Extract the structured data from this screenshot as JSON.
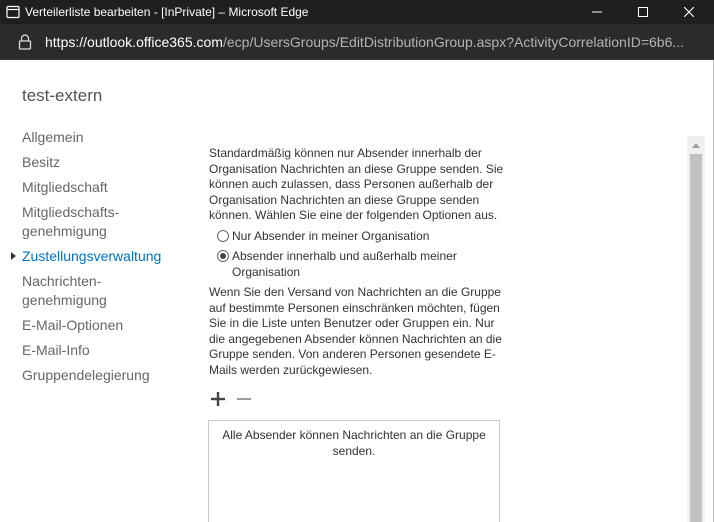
{
  "window": {
    "title": "Verteilerliste bearbeiten - [InPrivate] – Microsoft Edge",
    "app_icon": "edge-page-icon",
    "controls": [
      "minimize-icon",
      "maximize-icon",
      "close-icon"
    ]
  },
  "address_bar": {
    "lock_icon": "lock-icon",
    "url_prefix": "https://",
    "url_host": "outlook.office365.com",
    "url_path": "/ecp/UsersGroups/EditDistributionGroup.aspx?ActivityCorrelationID=6b6..."
  },
  "dialog": {
    "title": "test-extern"
  },
  "nav": {
    "items": [
      {
        "label": "Allgemein"
      },
      {
        "label": "Besitz"
      },
      {
        "label": "Mitgliedschaft"
      },
      {
        "label": "Mitgliedschafts-\ngenehmigung"
      },
      {
        "label": "Zustellungsverwaltung",
        "active": true
      },
      {
        "label": "Nachrichten-\ngenehmigung"
      },
      {
        "label": "E-Mail-Optionen"
      },
      {
        "label": "E-Mail-Info"
      },
      {
        "label": "Gruppendelegierung"
      }
    ]
  },
  "delivery": {
    "intro": "Standardmäßig können nur Absender innerhalb der Organisation Nachrichten an diese Gruppe senden. Sie können auch zulassen, dass Personen außerhalb der Organisation Nachrichten an diese Gruppe senden können. Wählen Sie eine der folgenden Optionen aus.",
    "options": [
      {
        "label": "Nur Absender in meiner Organisation",
        "checked": false
      },
      {
        "label": "Absender innerhalb und außerhalb meiner Organisation",
        "checked": true
      }
    ],
    "restrict_text": "Wenn Sie den Versand von Nachrichten an die Gruppe auf bestimmte Personen einschränken möchten, fügen Sie in die Liste unten Benutzer oder Gruppen ein. Nur die angegebenen Absender können Nachrichten an die Gruppe senden. Von anderen Personen gesendete E-Mails werden zurückgewiesen.",
    "toolbar": [
      "add-icon",
      "remove-icon"
    ],
    "empty_list_message": "Alle Absender können Nachrichten an die Gruppe senden."
  },
  "colors": {
    "accent": "#0072c6",
    "titlebar": "#1f1f1f",
    "addressbar": "#2b2b2b",
    "text": "#333333",
    "nav_text": "#666666"
  }
}
